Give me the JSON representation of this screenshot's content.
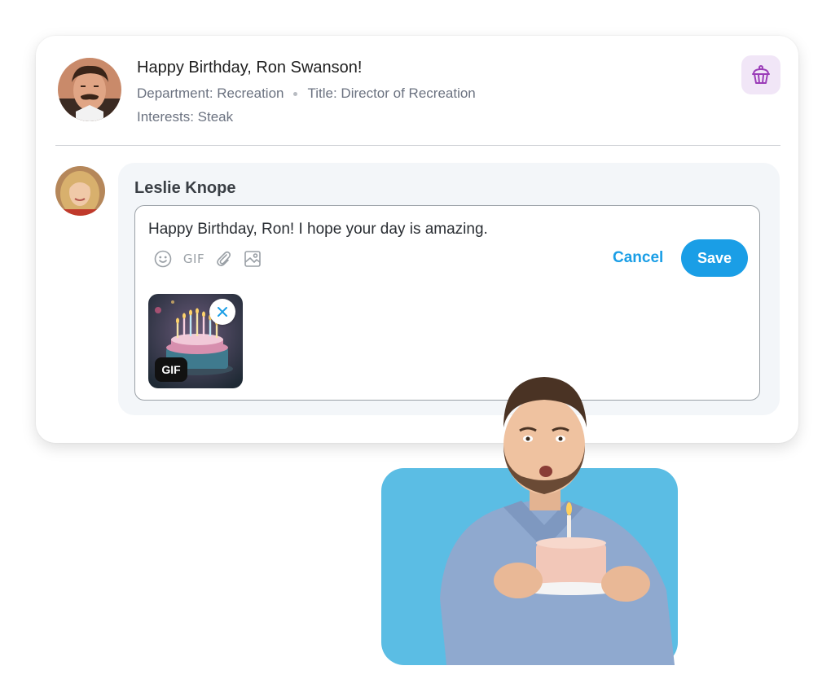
{
  "header": {
    "title": "Happy Birthday, Ron Swanson!",
    "department": "Department: Recreation",
    "job_title": "Title: Director of Recreation",
    "interests": "Interests: Steak",
    "celebration_icon": "cupcake-icon",
    "accent_color": "#9b3db8"
  },
  "comment": {
    "author": "Leslie Knope",
    "text": "Happy Birthday, Ron! I hope your day is amazing.",
    "toolbar": {
      "emoji_icon": "emoji-icon",
      "gif_label": "GIF",
      "attach_icon": "paperclip-icon",
      "image_icon": "image-icon"
    },
    "cancel_label": "Cancel",
    "save_label": "Save",
    "attachment": {
      "badge": "GIF",
      "remove_icon": "close-icon"
    }
  },
  "colors": {
    "primary": "#1a9ee6",
    "promo_background": "#5bbde4"
  }
}
